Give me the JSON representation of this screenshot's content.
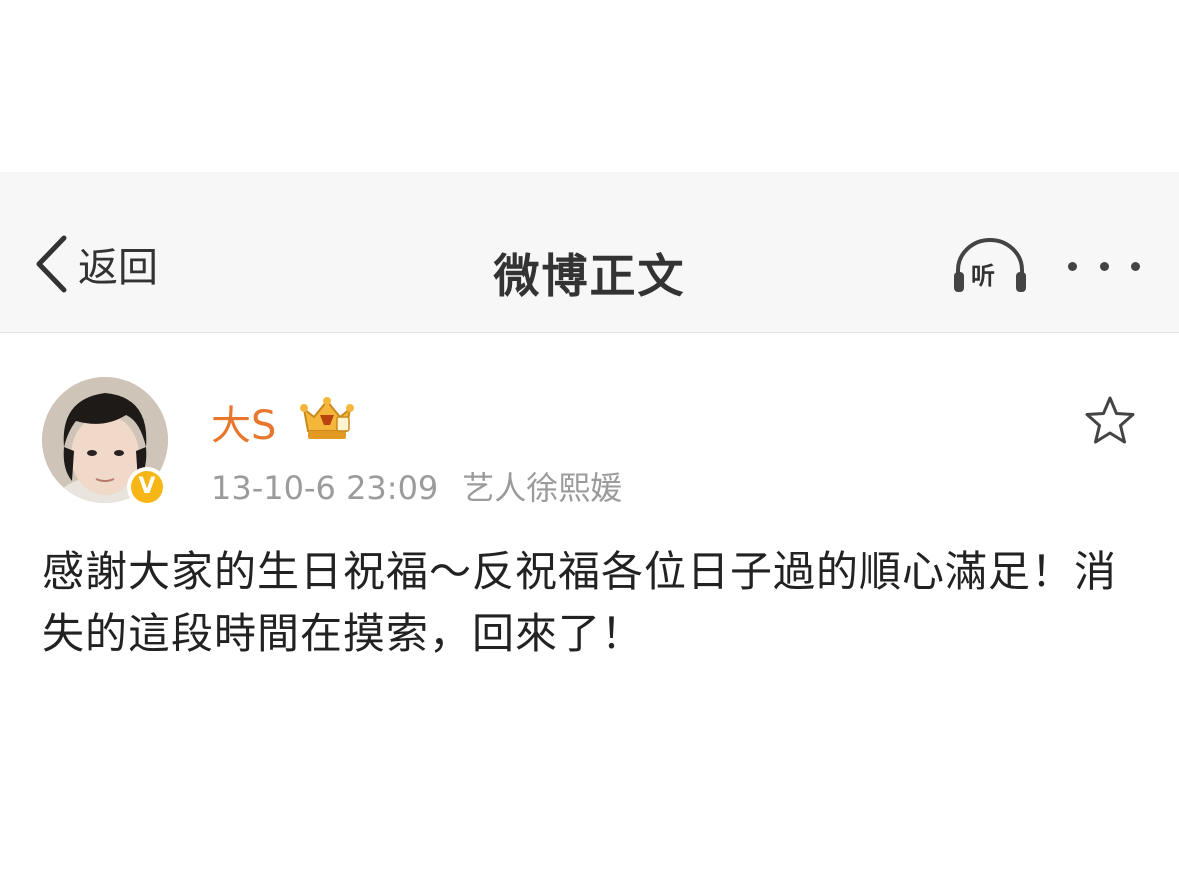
{
  "navbar": {
    "back_label": "返回",
    "title": "微博正文",
    "listen_label": "听",
    "back_icon": "chevron-left-icon",
    "listen_icon": "headphones-icon",
    "more_icon": "more-dots-icon"
  },
  "post": {
    "username": "大S",
    "verify_label": "V",
    "timestamp": "13-10-6 23:09",
    "source": "艺人徐熙媛",
    "content": "感謝大家的生日祝福～反祝福各位日子過的順心滿足！消失的這段時間在摸索，回來了！",
    "favorite_icon": "star-outline-icon",
    "vip_icon": "vip-crown-icon"
  },
  "colors": {
    "accent": "#e8772e",
    "verify": "#f6b716",
    "meta_text": "#9b9b9b",
    "navbar_bg": "#f7f7f7"
  }
}
